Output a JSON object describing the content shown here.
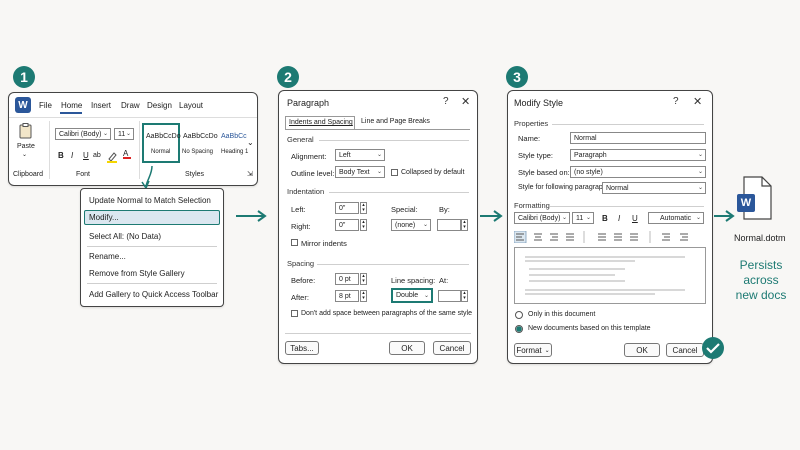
{
  "steps": [
    "1",
    "2",
    "3"
  ],
  "ribbon": {
    "app_logo": "W",
    "tabs": [
      "File",
      "Home",
      "Insert",
      "Draw",
      "Design",
      "Layout"
    ],
    "active_tab": "Home",
    "paste_label": "Paste",
    "font_name": "Calibri (Body)",
    "font_size": "11",
    "format_buttons": [
      "B",
      "I",
      "U",
      "ab",
      "A"
    ],
    "style_samples": [
      {
        "sample": "AaBbCcDo",
        "name": "Normal"
      },
      {
        "sample": "AaBbCcDo",
        "name": "No Spacing"
      },
      {
        "sample": "AaBbCc",
        "name": "Heading 1"
      }
    ],
    "group_labels": {
      "clipboard": "Clipboard",
      "font": "Font",
      "styles": "Styles"
    }
  },
  "context_menu": {
    "items": [
      "Update Normal to Match Selection",
      "Modify...",
      "Select All: (No Data)",
      "Rename...",
      "Remove from Style Gallery",
      "Add Gallery to Quick Access Toolbar"
    ],
    "highlighted_index": 1
  },
  "paragraph_dialog": {
    "title": "Paragraph",
    "help": "?",
    "close": "✕",
    "tabs": [
      "Indents and Spacing",
      "Line and Page Breaks"
    ],
    "general_label": "General",
    "alignment_label": "Alignment:",
    "alignment_value": "Left",
    "outline_label": "Outline level:",
    "outline_value": "Body Text",
    "collapsed_label": "Collapsed by default",
    "indentation_label": "Indentation",
    "left_label": "Left:",
    "left_value": "0\"",
    "right_label": "Right:",
    "right_value": "0\"",
    "special_label": "Special:",
    "special_value": "(none)",
    "by_label": "By:",
    "mirror_label": "Mirror indents",
    "spacing_label": "Spacing",
    "before_label": "Before:",
    "before_value": "0 pt",
    "after_label": "After:",
    "after_value": "8 pt",
    "line_spacing_label": "Line spacing:",
    "line_spacing_value": "Double",
    "at_label": "At:",
    "dont_add_label": "Don't add space between paragraphs of the same style",
    "tabs_button": "Tabs...",
    "ok_button": "OK",
    "cancel_button": "Cancel"
  },
  "modify_dialog": {
    "title": "Modify Style",
    "help": "?",
    "close": "✕",
    "properties_label": "Properties",
    "name_label": "Name:",
    "name_value": "Normal",
    "style_type_label": "Style type:",
    "style_type_value": "Paragraph",
    "based_on_label": "Style based on:",
    "based_on_value": "(no style)",
    "following_label": "Style for following paragraph:",
    "following_value": "Normal",
    "formatting_label": "Formatting",
    "font_name": "Calibri (Body)",
    "font_size": "11",
    "format_buttons": [
      "B",
      "I",
      "U"
    ],
    "color_value": "Automatic",
    "only_doc_label": "Only in this document",
    "new_docs_label": "New documents based on this template",
    "format_button": "Format",
    "ok_button": "OK",
    "cancel_button": "Cancel"
  },
  "result": {
    "file_icon_letter": "W",
    "file_name": "Normal.dotm",
    "note_lines": [
      "Persists",
      "across",
      "new docs"
    ]
  },
  "colors": {
    "accent": "#1d7a73",
    "word_blue": "#2b579a",
    "highlight": "#dbe7f0"
  }
}
